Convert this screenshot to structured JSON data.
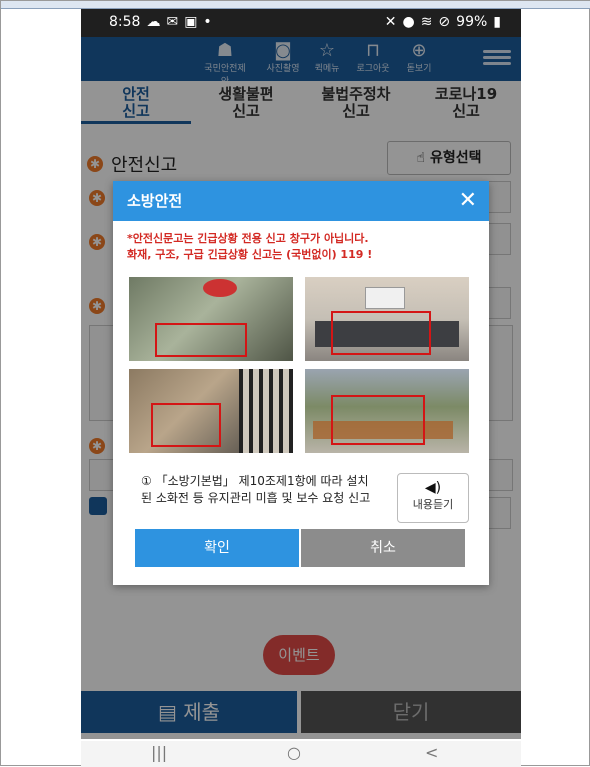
{
  "status_bar": {
    "time": "8:58",
    "battery": "99%"
  },
  "app_header": {
    "icons": [
      {
        "label": "국민안전제안",
        "icon": "person-stack-icon"
      },
      {
        "label": "사진촬영",
        "icon": "camera-icon"
      },
      {
        "label": "퀵메뉴",
        "icon": "star-icon"
      },
      {
        "label": "로그아웃",
        "icon": "lock-icon"
      },
      {
        "label": "돋보기",
        "icon": "zoom-icon"
      }
    ]
  },
  "tabs": [
    {
      "line1": "안전",
      "line2": "신고",
      "active": true
    },
    {
      "line1": "생활불편",
      "line2": "신고",
      "active": false
    },
    {
      "line1": "불법주정차",
      "line2": "신고",
      "active": false
    },
    {
      "line1": "코로나19",
      "line2": "신고",
      "active": false
    }
  ],
  "page": {
    "section_title": "안전신고",
    "type_button": "유형선택",
    "event_button": "이벤트",
    "submit_button": "제출",
    "close_button": "닫기",
    "nav": {
      "recent": "|||",
      "home": "○",
      "back": "<"
    }
  },
  "modal": {
    "title": "소방안전",
    "notice_line1": "*안전신문고는 긴급상황 전용 신고 창구가 아닙니다.",
    "notice_line2": "화재, 구조, 구급 긴급상황 신고는 (국번없이) 119 !",
    "description": "① 「소방기본법」 제10조제1항에 따라 설치된 소화전 등 유지관리 미흡 및 보수 요청 신고",
    "listen_label": "내용듣기",
    "ok_label": "확인",
    "cancel_label": "취소"
  },
  "colors": {
    "header_blue": "#1c5d9e",
    "modal_blue": "#2e93e0",
    "notice_red": "#d32a24",
    "required_orange": "#f07a2a",
    "event_red": "#e24a48"
  }
}
